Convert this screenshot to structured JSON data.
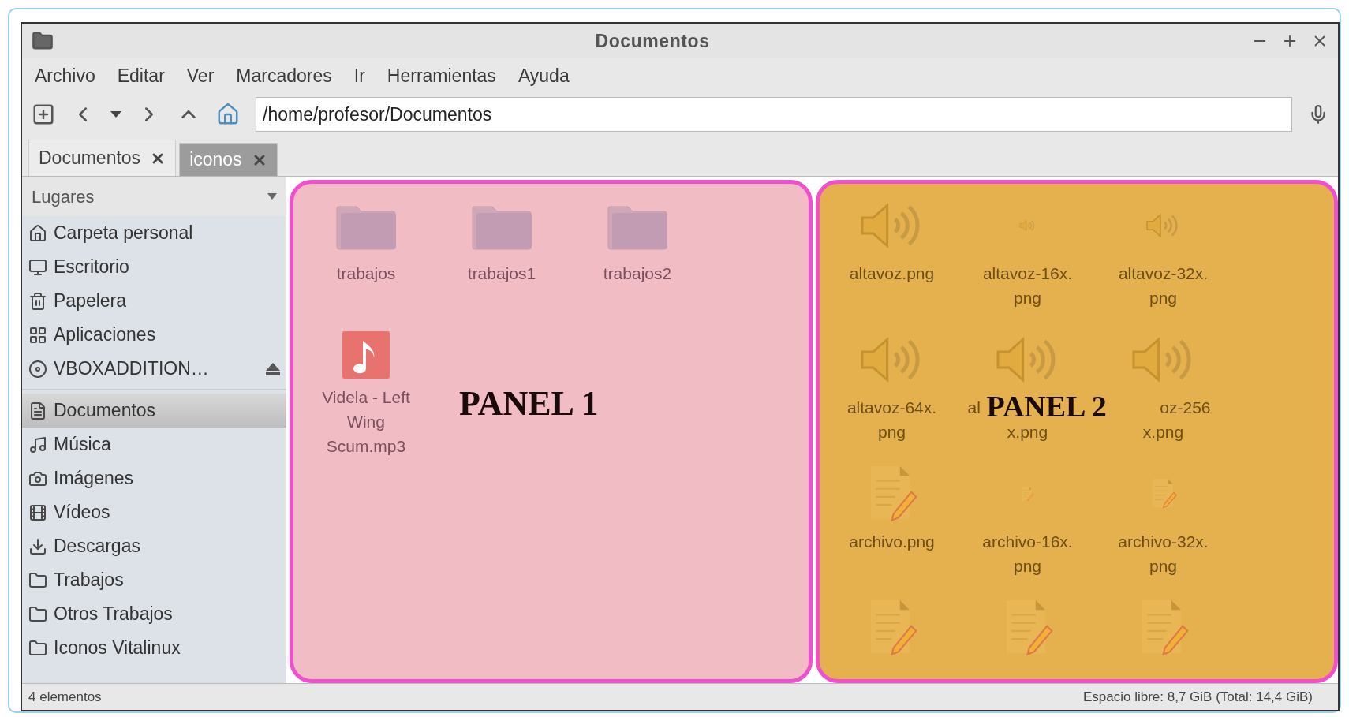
{
  "window": {
    "title": "Documentos"
  },
  "menu": [
    "Archivo",
    "Editar",
    "Ver",
    "Marcadores",
    "Ir",
    "Herramientas",
    "Ayuda"
  ],
  "location": {
    "value": "/home/profesor/Documentos"
  },
  "tabs": [
    {
      "label": "Documentos",
      "selected": true
    },
    {
      "label": "iconos",
      "selected": false
    }
  ],
  "sidebar": {
    "header": "Lugares",
    "sections": [
      {
        "items": [
          {
            "label": "Carpeta personal",
            "kind": "home",
            "selected": false,
            "eject": false
          },
          {
            "label": "Escritorio",
            "kind": "desktop",
            "selected": false,
            "eject": false
          },
          {
            "label": "Papelera",
            "kind": "trash",
            "selected": false,
            "eject": false
          },
          {
            "label": "Aplicaciones",
            "kind": "apps",
            "selected": false,
            "eject": false
          },
          {
            "label": "VBOXADDITION…",
            "kind": "disc",
            "selected": false,
            "eject": true
          }
        ]
      },
      {
        "items": [
          {
            "label": "Documentos",
            "kind": "document",
            "selected": true,
            "eject": false
          },
          {
            "label": "Música",
            "kind": "music",
            "selected": false,
            "eject": false
          },
          {
            "label": "Imágenes",
            "kind": "camera",
            "selected": false,
            "eject": false
          },
          {
            "label": "Vídeos",
            "kind": "film",
            "selected": false,
            "eject": false
          },
          {
            "label": "Descargas",
            "kind": "download",
            "selected": false,
            "eject": false
          },
          {
            "label": "Trabajos",
            "kind": "folder",
            "selected": false,
            "eject": false
          },
          {
            "label": "Otros Trabajos",
            "kind": "folder",
            "selected": false,
            "eject": false
          },
          {
            "label": "Iconos Vitalinux",
            "kind": "folder",
            "selected": false,
            "eject": false
          }
        ]
      }
    ]
  },
  "panes": [
    {
      "annotation": "PANEL 1",
      "color": "#f1bcc3",
      "items": [
        {
          "kind": "folder",
          "label": [
            "trabajos"
          ]
        },
        {
          "kind": "folder",
          "label": [
            "trabajos1"
          ]
        },
        {
          "kind": "folder",
          "label": [
            "trabajos2"
          ]
        },
        {
          "kind": "audio",
          "label": [
            "Videla - Left",
            "Wing",
            "Scum.mp3"
          ]
        }
      ]
    },
    {
      "annotation": "PANEL 2",
      "color": "#e5b14f",
      "items": [
        {
          "kind": "speaker",
          "label": [
            "altavoz.png"
          ]
        },
        {
          "kind": "speaker",
          "label": [
            "altavoz-16x.",
            "png"
          ]
        },
        {
          "kind": "speaker",
          "label": [
            "altavoz-32x.",
            "png"
          ]
        },
        {
          "kind": "speaker",
          "label": [
            "altavoz-64x.",
            "png"
          ]
        },
        {
          "kind": "speaker",
          "label": [
            "al",
            "x.png"
          ]
        },
        {
          "kind": "speaker",
          "label": [
            "oz-256",
            "x.png"
          ]
        },
        {
          "kind": "document",
          "label": [
            "archivo.png"
          ]
        },
        {
          "kind": "document",
          "label": [
            "archivo-16x.",
            "png"
          ]
        },
        {
          "kind": "document",
          "label": [
            "archivo-32x.",
            "png"
          ]
        },
        {
          "kind": "document"
        },
        {
          "kind": "document"
        },
        {
          "kind": "document"
        }
      ]
    }
  ],
  "status_bar": {
    "left": "4 elementos",
    "right": "Espacio libre: 8,7 GiB (Total: 14,4 GiB)"
  }
}
